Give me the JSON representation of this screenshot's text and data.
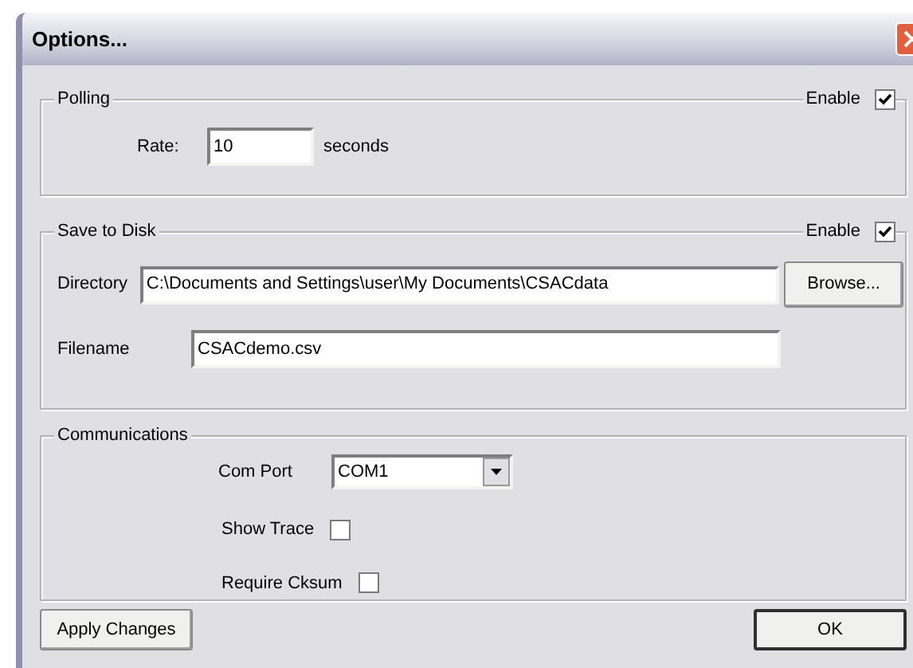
{
  "window": {
    "title": "Options..."
  },
  "polling": {
    "title": "Polling",
    "enable_label": "Enable",
    "enabled": true,
    "rate_label": "Rate:",
    "rate": "10",
    "rate_unit": "seconds"
  },
  "save_to_disk": {
    "title": "Save to Disk",
    "enable_label": "Enable",
    "enabled": true,
    "directory_label": "Directory",
    "directory": "C:\\Documents and Settings\\user\\My Documents\\CSACdata",
    "browse_button": "Browse...",
    "filename_label": "Filename",
    "filename": "CSACdemo.csv"
  },
  "communications": {
    "title": "Communications",
    "com_port_label": "Com Port",
    "com_port": "COM1",
    "options": [
      {
        "label": "Show Trace",
        "checked": false
      },
      {
        "label": "Require Cksum",
        "checked": false
      }
    ]
  },
  "buttons": [
    {
      "label": "Apply Changes",
      "default": false
    },
    {
      "label": "OK",
      "default": true
    }
  ]
}
